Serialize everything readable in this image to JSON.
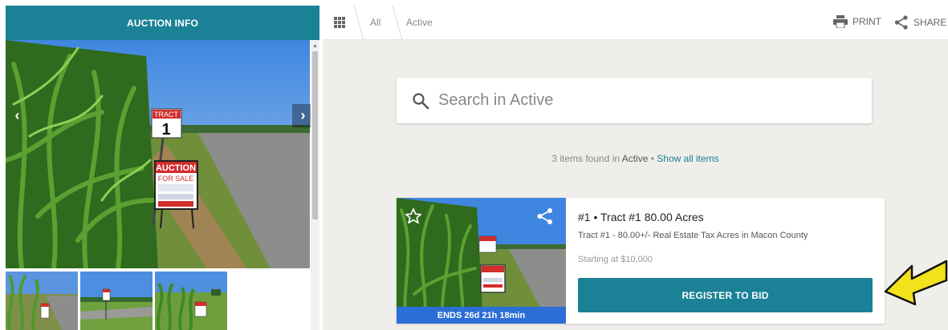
{
  "left_panel": {
    "tab_label": "AUCTION INFO",
    "hero_sign": {
      "tract_word": "TRACT",
      "tract_number": "1",
      "auction_word": "AUCTION",
      "for_sale": "FOR SALE"
    },
    "thumbnails": [
      "thumb-1",
      "thumb-2",
      "thumb-3"
    ]
  },
  "topbar": {
    "breadcrumb": [
      "All",
      "Active"
    ],
    "print_label": "PRINT",
    "share_label": "SHARE"
  },
  "search": {
    "placeholder": "Search in Active"
  },
  "results": {
    "count_text": "3 items found in",
    "category": "Active",
    "separator": "•",
    "show_all": "Show all items"
  },
  "lot": {
    "title": "#1 • Tract #1 80.00 Acres",
    "subtitle": "Tract #1 - 80.00+/- Real Estate Tax Acres in Macon County",
    "price": "Starting at $10,000",
    "button_label": "REGISTER TO BID",
    "ends": "ENDS 26d 21h 18min"
  },
  "colors": {
    "accent": "#1a8196",
    "ends_bar": "#2b6ed6",
    "annotation_arrow": "#f2e21c"
  }
}
